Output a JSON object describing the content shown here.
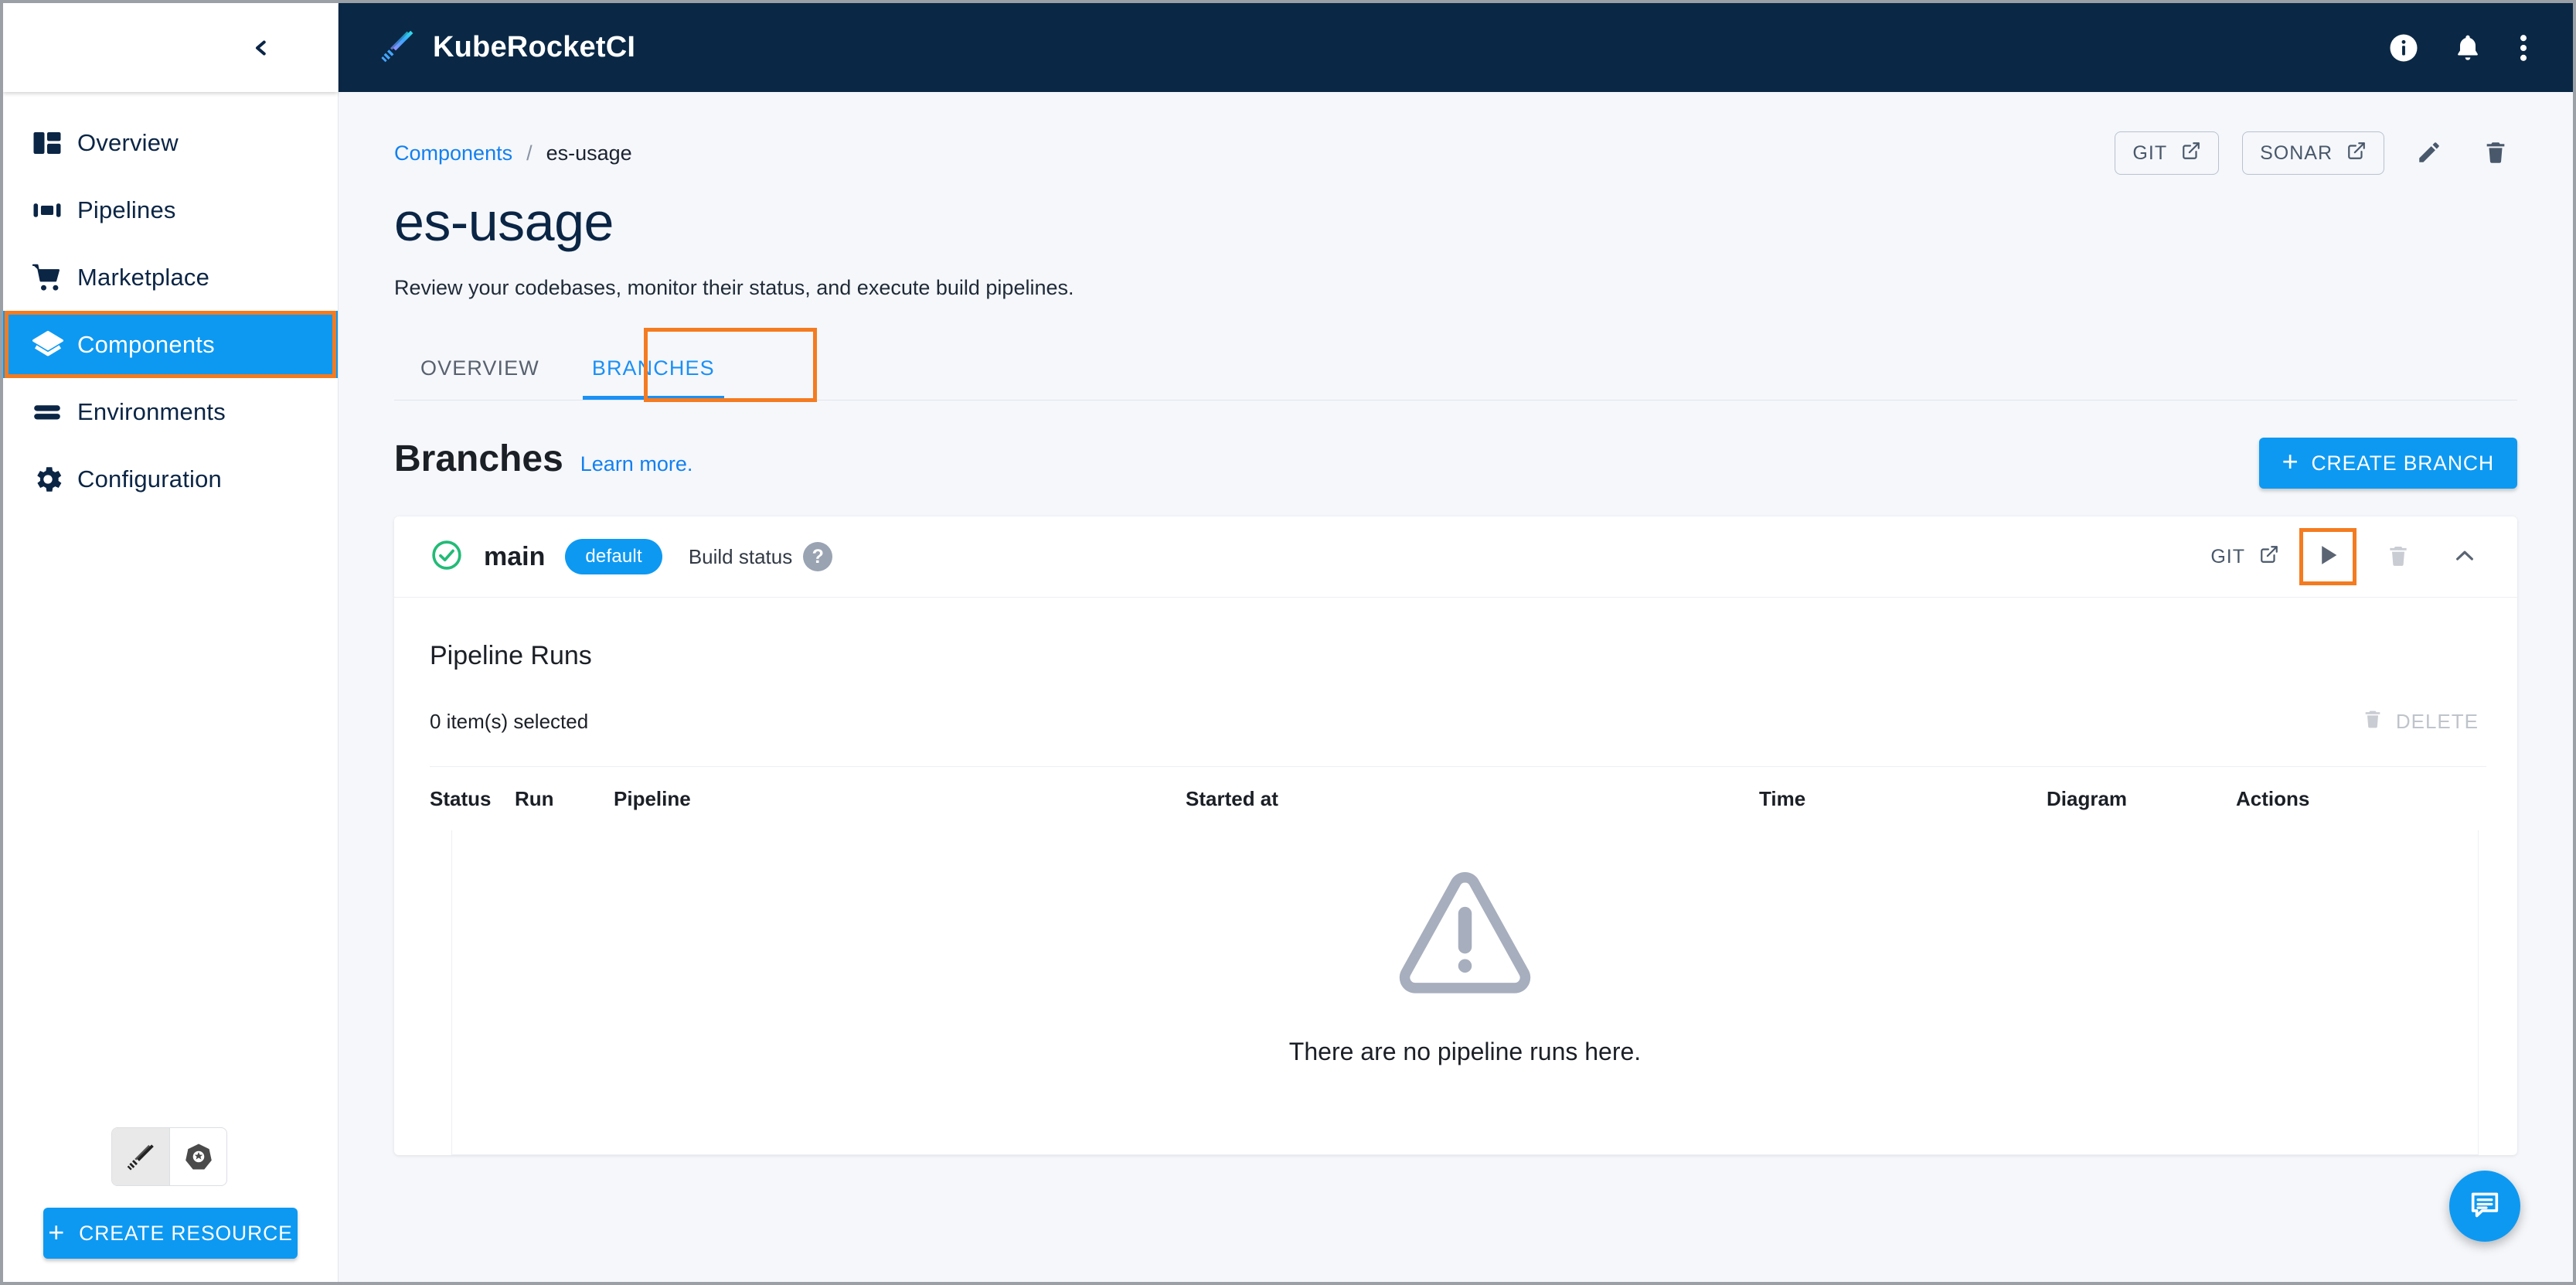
{
  "app": {
    "brand_name": "KubeRocketCI",
    "accent_blue": "#0d99f2",
    "header_navy": "#0a2845",
    "highlight_orange": "#f47b20"
  },
  "sidebar": {
    "collapse_icon": "chevron-left-icon",
    "items": [
      {
        "label": "Overview",
        "icon": "dashboard-icon",
        "active": false
      },
      {
        "label": "Pipelines",
        "icon": "pipelines-icon",
        "active": false
      },
      {
        "label": "Marketplace",
        "icon": "cart-icon",
        "active": false
      },
      {
        "label": "Components",
        "icon": "layers-icon",
        "active": true
      },
      {
        "label": "Environments",
        "icon": "stack-icon",
        "active": false
      },
      {
        "label": "Configuration",
        "icon": "gear-icon",
        "active": false
      }
    ],
    "cluster_toggle": [
      {
        "icon": "kuberocket-logo-icon",
        "selected": true
      },
      {
        "icon": "kubernetes-icon",
        "selected": false
      }
    ],
    "create_resource_label": "CREATE RESOURCE",
    "create_resource_plus": "+"
  },
  "topbar": {
    "logo_icon": "rocket-feather-logo-icon",
    "actions": [
      {
        "icon": "info-icon"
      },
      {
        "icon": "bell-icon"
      },
      {
        "icon": "more-vertical-icon"
      }
    ]
  },
  "breadcrumb": {
    "parent": "Components",
    "separator": "/",
    "current": "es-usage"
  },
  "header_actions": {
    "git_label": "GIT",
    "sonar_label": "SONAR",
    "edit_icon": "pencil-icon",
    "delete_icon": "trash-icon",
    "external_icon": "external-link-icon"
  },
  "page": {
    "title": "es-usage",
    "subtitle": "Review your codebases, monitor their status, and execute build pipelines."
  },
  "tabs": [
    {
      "label": "OVERVIEW",
      "active": false,
      "highlighted": false
    },
    {
      "label": "BRANCHES",
      "active": true,
      "highlighted": true
    }
  ],
  "branches_section": {
    "title": "Branches",
    "learn_more": "Learn more.",
    "create_branch_label": "CREATE BRANCH",
    "create_branch_plus": "+"
  },
  "branch": {
    "status_icon": "check-circle-icon",
    "name": "main",
    "badge": "default",
    "build_status_label": "Build status",
    "help_glyph": "?",
    "git_label": "GIT",
    "run_icon": "play-icon",
    "run_highlighted": true,
    "delete_icon": "trash-icon",
    "collapse_icon": "chevron-up-icon"
  },
  "pipeline_runs": {
    "title": "Pipeline Runs",
    "selected_count_text": "0 item(s) selected",
    "delete_label": "DELETE",
    "delete_icon": "trash-icon",
    "columns": [
      "Status",
      "Run",
      "Pipeline",
      "Started at",
      "Time",
      "Diagram",
      "Actions"
    ],
    "empty_icon": "warning-triangle-icon",
    "empty_text": "There are no pipeline runs here."
  },
  "chat": {
    "icon": "chat-bubble-icon"
  }
}
